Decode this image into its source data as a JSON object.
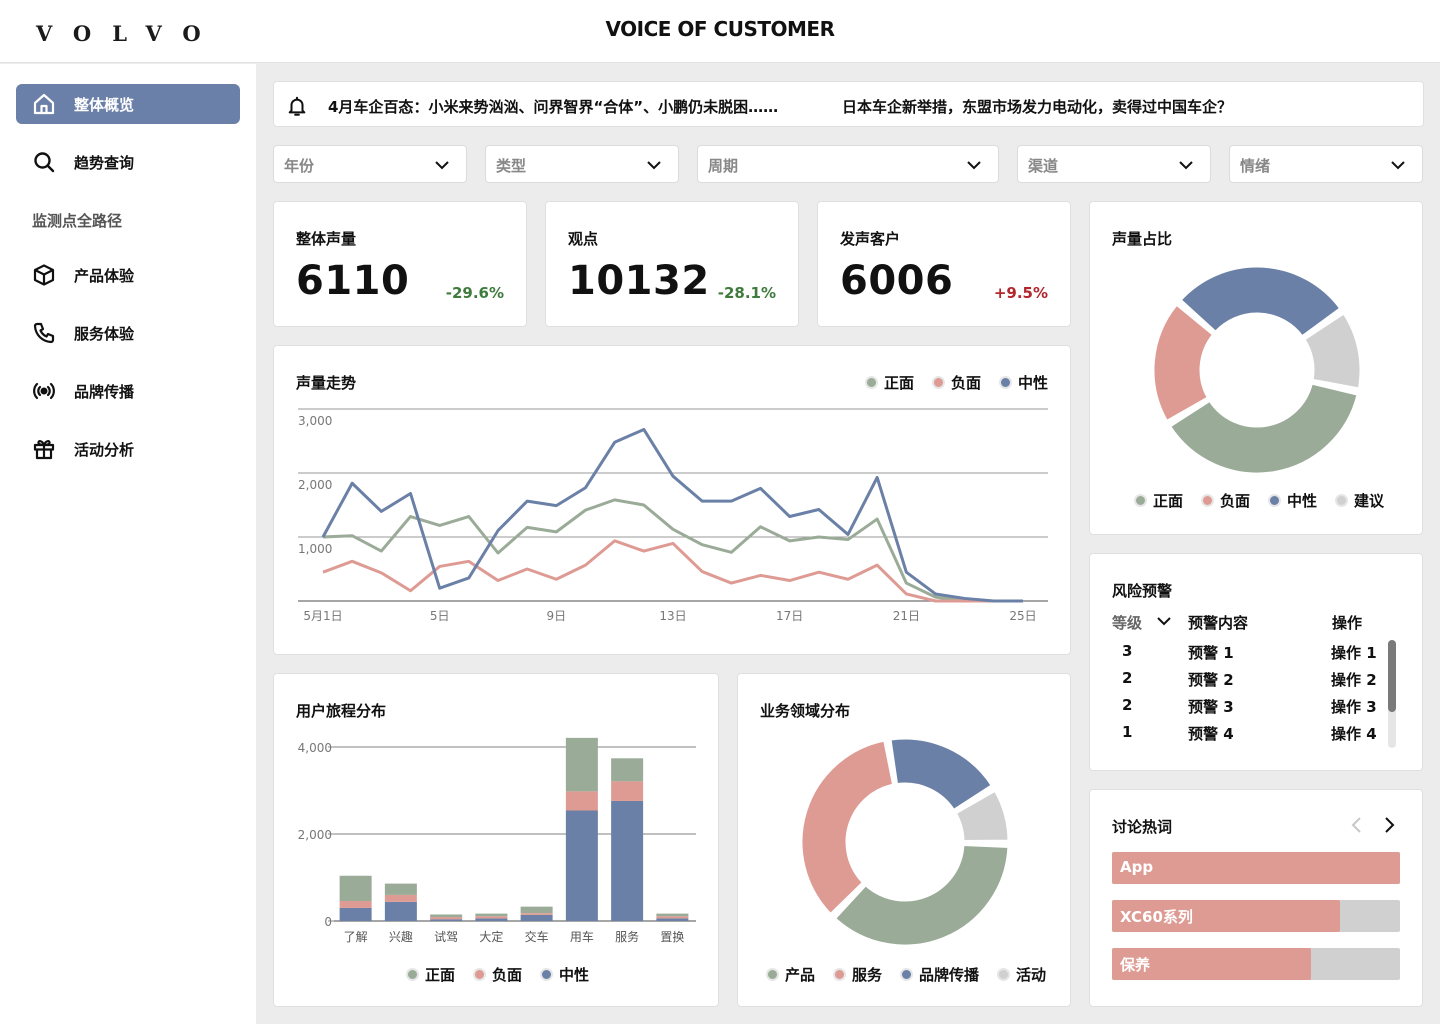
{
  "brand": {
    "logo": "VOLVO",
    "title": "VOICE OF CUSTOMER"
  },
  "colors": {
    "positive": "#9aab98",
    "negative": "#de9b93",
    "neutral": "#6a80a6",
    "suggestion": "#d0d0d0",
    "active_nav": "#6b80a8",
    "pos_change": "#3f7b3c",
    "neg_change": "#b3262c"
  },
  "sidebar": {
    "items": [
      {
        "label": "整体概览",
        "icon": "home-icon"
      },
      {
        "label": "趋势查询",
        "icon": "search-icon"
      },
      {
        "label": "产品体验",
        "icon": "cube-icon"
      },
      {
        "label": "服务体验",
        "icon": "phone-icon"
      },
      {
        "label": "品牌传播",
        "icon": "broadcast-icon"
      },
      {
        "label": "活动分析",
        "icon": "gift-icon"
      }
    ],
    "section_label": "监测点全路径"
  },
  "notice": {
    "items": [
      "4月车企百态：小米来势汹汹、问界智界“合体”、小鹏仍未脱困……",
      "日本车企新举措，东盟市场发力电动化，卖得过中国车企？"
    ]
  },
  "filters": [
    {
      "placeholder": "年份"
    },
    {
      "placeholder": "类型"
    },
    {
      "placeholder": "周期"
    },
    {
      "placeholder": "渠道"
    },
    {
      "placeholder": "情绪"
    }
  ],
  "kpis": [
    {
      "label": "整体声量",
      "value": "6110",
      "change": "-29.6%"
    },
    {
      "label": "观点",
      "value": "10132",
      "change": "-28.1%"
    },
    {
      "label": "发声客户",
      "value": "6006",
      "change": "+9.5%"
    }
  ],
  "risk": {
    "title": "风险预警",
    "headers": {
      "level": "等级",
      "content": "预警内容",
      "action": "操作"
    },
    "rows": [
      {
        "level": "3",
        "content": "预警 1",
        "action": "操作 1"
      },
      {
        "level": "2",
        "content": "预警 2",
        "action": "操作 2"
      },
      {
        "level": "2",
        "content": "预警 3",
        "action": "操作 3"
      },
      {
        "level": "1",
        "content": "预警 4",
        "action": "操作 4"
      }
    ]
  },
  "hotwords": {
    "title": "讨论热词",
    "items": [
      {
        "label": "App",
        "share": 1.0
      },
      {
        "label": "XC60系列",
        "share": 0.79
      },
      {
        "label": "保养",
        "share": 0.69
      }
    ]
  },
  "chart_data": [
    {
      "type": "line",
      "title": "声量走势",
      "x": [
        "5月1日",
        "5月2日",
        "5月3日",
        "5月4日",
        "5月5日",
        "5月6日",
        "5月7日",
        "5月8日",
        "5月9日",
        "5月10日",
        "5月11日",
        "5月12日",
        "5月13日",
        "5月14日",
        "5月15日",
        "5月16日",
        "5月17日",
        "5月18日",
        "5月19日",
        "5月20日",
        "5月21日",
        "5月22日",
        "5月23日",
        "5月24日",
        "5月25日"
      ],
      "x_ticks": [
        "5月1日",
        "5日",
        "9日",
        "13日",
        "17日",
        "21日",
        "25日"
      ],
      "ylim": [
        0,
        3000
      ],
      "y_ticks": [
        "3,000",
        "2,000",
        "1,000"
      ],
      "grid": true,
      "legend": "top-right",
      "series": [
        {
          "name": "正面",
          "values": [
            1000,
            1020,
            780,
            1320,
            1180,
            1320,
            750,
            1150,
            1080,
            1420,
            1580,
            1500,
            1120,
            880,
            760,
            1160,
            940,
            1000,
            960,
            1280,
            280,
            60,
            0,
            0,
            0
          ]
        },
        {
          "name": "负面",
          "values": [
            450,
            620,
            440,
            160,
            540,
            620,
            320,
            500,
            340,
            560,
            940,
            780,
            900,
            460,
            280,
            400,
            320,
            450,
            340,
            560,
            110,
            0,
            0,
            0,
            0
          ]
        },
        {
          "name": "中性",
          "values": [
            1000,
            1840,
            1400,
            1680,
            200,
            360,
            1100,
            1560,
            1490,
            1770,
            2480,
            2680,
            1950,
            1560,
            1560,
            1760,
            1320,
            1430,
            1040,
            1930,
            450,
            110,
            40,
            0,
            0
          ]
        }
      ]
    },
    {
      "type": "pie",
      "title": "声量占比",
      "donut": true,
      "legend": "bottom",
      "categories": [
        "正面",
        "负面",
        "中性",
        "建议"
      ],
      "values": [
        38,
        20,
        29,
        13
      ]
    },
    {
      "type": "bar",
      "title": "用户旅程分布",
      "stacked": true,
      "categories": [
        "了解",
        "兴趣",
        "试驾",
        "大定",
        "交车",
        "用车",
        "服务",
        "置换"
      ],
      "ylim": [
        0,
        4000
      ],
      "y_ticks": [
        "4,000",
        "2,000",
        "0"
      ],
      "legend": "bottom",
      "series": [
        {
          "name": "中性",
          "values": [
            300,
            440,
            40,
            60,
            140,
            2540,
            2760,
            60
          ]
        },
        {
          "name": "负面",
          "values": [
            160,
            160,
            50,
            50,
            40,
            440,
            450,
            50
          ]
        },
        {
          "name": "正面",
          "values": [
            580,
            260,
            60,
            60,
            150,
            1230,
            530,
            60
          ]
        }
      ]
    },
    {
      "type": "pie",
      "title": "业务领域分布",
      "donut": true,
      "legend": "bottom",
      "categories": [
        "产品",
        "服务",
        "品牌传播",
        "活动"
      ],
      "values": [
        37,
        35,
        19,
        9
      ]
    }
  ]
}
